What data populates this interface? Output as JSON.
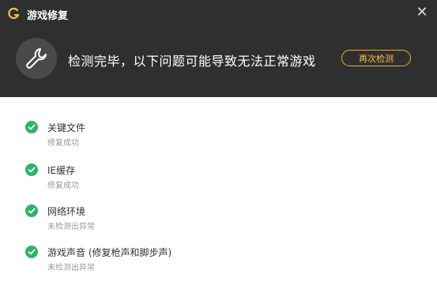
{
  "window": {
    "title": "游戏修复"
  },
  "header": {
    "message": "检测完毕，以下问题可能导致无法正常游戏",
    "recheck_label": "再次检测"
  },
  "items": [
    {
      "label": "关键文件",
      "status": "修复成功"
    },
    {
      "label": "IE缓存",
      "status": "修复成功"
    },
    {
      "label": "网络环境",
      "status": "未检测出异常"
    },
    {
      "label": "游戏声音 (修复枪声和脚步声)",
      "status": "未检测出异常"
    }
  ],
  "colors": {
    "header_bg": "#2f2f2f",
    "accent": "#f0c24a",
    "success": "#2fb36a"
  }
}
